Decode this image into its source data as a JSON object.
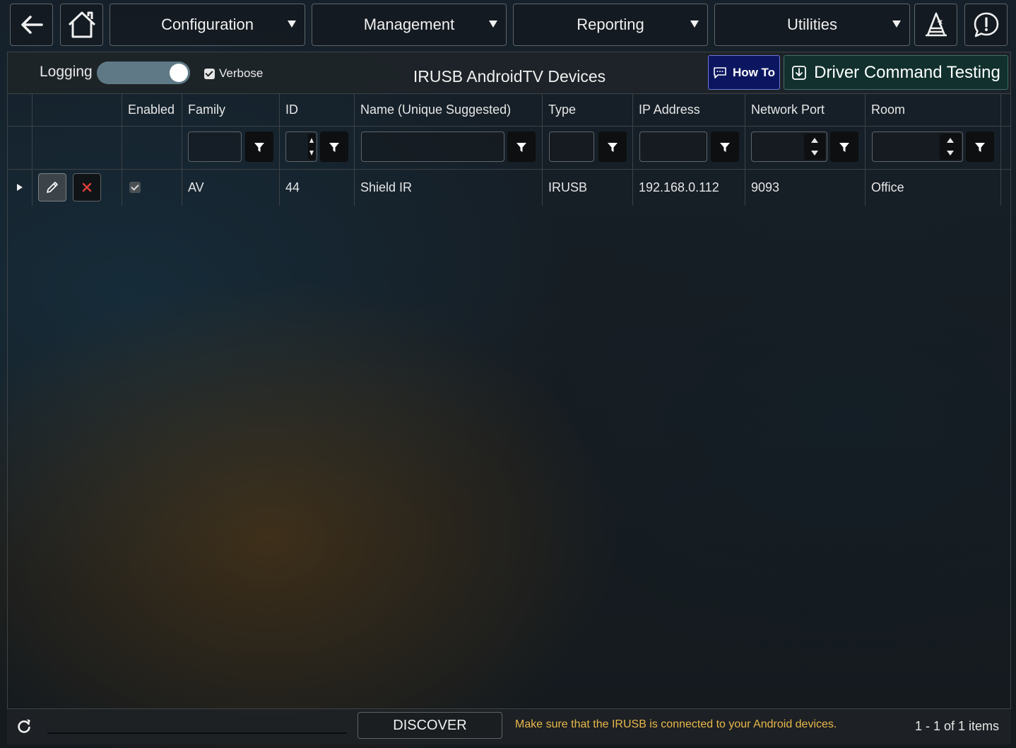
{
  "nav": {
    "configuration": "Configuration",
    "management": "Management",
    "reporting": "Reporting",
    "utilities": "Utilities"
  },
  "toolbar": {
    "logging_label": "Logging",
    "logging_on": true,
    "verbose_label": "Verbose",
    "verbose_checked": true,
    "title": "IRUSB AndroidTV Devices",
    "how_to_label": "How To",
    "driver_testing_label": "Driver Command Testing"
  },
  "grid": {
    "headers": {
      "enabled": "Enabled",
      "family": "Family",
      "id": "ID",
      "name": "Name (Unique Suggested)",
      "type": "Type",
      "ip": "IP Address",
      "port": "Network Port",
      "room": "Room"
    },
    "rows": [
      {
        "enabled": true,
        "family": "AV",
        "id": "44",
        "name": "Shield IR",
        "type": "IRUSB",
        "ip": "192.168.0.112",
        "port": "9093",
        "room": "Office"
      }
    ]
  },
  "footer": {
    "discover_label": "DISCOVER",
    "hint": "Make sure that the IRUSB is connected to your Android devices.",
    "pager": "1 - 1 of 1 items"
  },
  "colors": {
    "hint": "#e8b84a",
    "delete": "#e0403a",
    "how_to_bg": "#0c1660",
    "driver_bg": "#11302e"
  }
}
